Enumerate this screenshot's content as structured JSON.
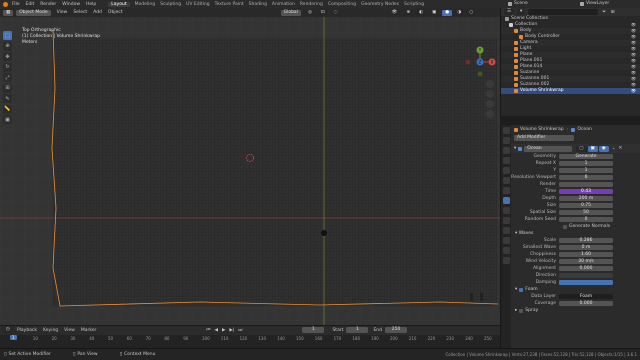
{
  "menu": [
    "File",
    "Edit",
    "Render",
    "Window",
    "Help"
  ],
  "workspaces": [
    "Layout",
    "Modeling",
    "Sculpting",
    "UV Editing",
    "Texture Paint",
    "Shading",
    "Animation",
    "Rendering",
    "Compositing",
    "Geometry Nodes",
    "Scripting"
  ],
  "active_workspace": "Layout",
  "scene": "Scene",
  "view_layer": "ViewLayer",
  "viewport": {
    "mode": "Object Mode",
    "menus": [
      "View",
      "Select",
      "Add",
      "Object"
    ],
    "transform": "Global",
    "info_lines": [
      "Top Orthographic",
      "(1) Collection | Volume Shrinkwrap",
      "Meters"
    ],
    "gizmo_labels": [
      "X",
      "Y",
      "Z"
    ]
  },
  "timeline": {
    "menus": [
      "Playback",
      "Keying",
      "View",
      "Marker"
    ],
    "current_frame": "1",
    "start_label": "Start",
    "start": "1",
    "end_label": "End",
    "end": "250",
    "ticks": [
      "0",
      "10",
      "20",
      "30",
      "40",
      "50",
      "60",
      "70",
      "80",
      "90",
      "100",
      "110",
      "120",
      "130",
      "140",
      "150",
      "160",
      "170",
      "180",
      "190",
      "200",
      "210",
      "220",
      "230",
      "240",
      "250"
    ],
    "current_indicator": "1"
  },
  "status": {
    "left": [
      "Set Active Modifier",
      "Pan View",
      "Context Menu"
    ],
    "right": "Collection | Volume Shrinkwrap | Verts:27,238 | Faces:52,128 | Tris:52,128 | Objects:1/15 | 3.6.1"
  },
  "outliner": {
    "header": "Scene Collection",
    "items": [
      {
        "label": "Collection",
        "color": "#d0d0d0",
        "indent": 0
      },
      {
        "label": "Body",
        "color": "#e08a3c",
        "indent": 1
      },
      {
        "label": "Body Controller",
        "color": "#e08a3c",
        "indent": 2
      },
      {
        "label": "Camera",
        "color": "#e08a3c",
        "indent": 1
      },
      {
        "label": "Light",
        "color": "#e08a3c",
        "indent": 1
      },
      {
        "label": "Plane",
        "color": "#e08a3c",
        "indent": 1
      },
      {
        "label": "Plane.001",
        "color": "#e08a3c",
        "indent": 1
      },
      {
        "label": "Plane.014",
        "color": "#e08a3c",
        "indent": 1
      },
      {
        "label": "Suzanne",
        "color": "#e08a3c",
        "indent": 1
      },
      {
        "label": "Suzanne.001",
        "color": "#e08a3c",
        "indent": 1
      },
      {
        "label": "Suzanne.002",
        "color": "#e08a3c",
        "indent": 1
      },
      {
        "label": "Volume Shrinkwrap",
        "color": "#e08a3c",
        "indent": 1
      }
    ],
    "selected_index": 11
  },
  "properties": {
    "object_name": "Volume Shrinkwrap",
    "modifier_tab": "Ocean",
    "add_modifier": "Add Modifier",
    "modifier_name": "Ocean",
    "rows": [
      {
        "label": "Geometry",
        "value": "Generate",
        "style": "normal"
      },
      {
        "label": "Repeat X",
        "value": "1",
        "style": "normal"
      },
      {
        "label": "Y",
        "value": "1",
        "style": "normal"
      },
      {
        "label": "Resolution Viewport",
        "value": "6",
        "style": "normal"
      },
      {
        "label": "Render",
        "value": "",
        "style": "normal"
      },
      {
        "label": "Time",
        "value": "0.43",
        "style": "purple"
      },
      {
        "label": "Depth",
        "value": "200 m",
        "style": "normal"
      },
      {
        "label": "Size",
        "value": "0.75",
        "style": "normal"
      },
      {
        "label": "Spatial Size",
        "value": "50",
        "style": "normal"
      },
      {
        "label": "Random Seed",
        "value": "0",
        "style": "normal"
      }
    ],
    "generate_normals": "Generate Normals",
    "waves_header": "Waves",
    "wave_rows": [
      {
        "label": "Scale",
        "value": "0.286",
        "style": "normal"
      },
      {
        "label": "Smallest Wave",
        "value": "0 m",
        "style": "normal"
      },
      {
        "label": "Choppiness",
        "value": "1.60",
        "style": "normal"
      },
      {
        "label": "Wind Velocity",
        "value": "30 m/s",
        "style": "normal"
      },
      {
        "label": "Alignment",
        "value": "0.000",
        "style": "normal"
      },
      {
        "label": "Direction",
        "value": "",
        "style": "dim"
      },
      {
        "label": "Damping",
        "value": "",
        "style": "blue"
      }
    ],
    "foam_header": "Foam",
    "foam_rows": [
      {
        "label": "Data Layer",
        "value": "Foam",
        "style": "dark"
      },
      {
        "label": "Coverage",
        "value": "0.000",
        "style": "normal"
      }
    ],
    "spray_header": "Spray"
  },
  "colors": {
    "accent": "#4772b3",
    "time_field": "#7a3cb4",
    "object_outline": "#f0902b",
    "grid_lines": "#1e1e1e"
  }
}
